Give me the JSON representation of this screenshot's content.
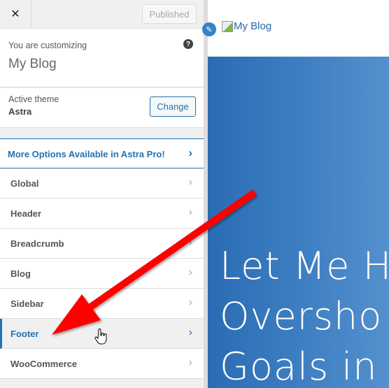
{
  "topbar": {
    "close_label": "✕",
    "published_label": "Published"
  },
  "info": {
    "customizing_label": "You are customizing",
    "site_name": "My Blog",
    "help_icon": "?"
  },
  "theme": {
    "label": "Active theme",
    "name": "Astra",
    "change_label": "Change"
  },
  "promo": {
    "label": "More Options Available in Astra Pro!"
  },
  "sections": [
    {
      "label": "Global",
      "active": false
    },
    {
      "label": "Header",
      "active": false
    },
    {
      "label": "Breadcrumb",
      "active": false
    },
    {
      "label": "Blog",
      "active": false
    },
    {
      "label": "Sidebar",
      "active": false
    },
    {
      "label": "Footer",
      "active": true
    },
    {
      "label": "WooCommerce",
      "active": false
    }
  ],
  "chevron": "›",
  "preview": {
    "logo_alt": "My Blog",
    "edit_icon": "✎",
    "hero_lines": [
      "Let Me H",
      "Oversho",
      "Goals in"
    ]
  },
  "colors": {
    "accent": "#2271b1",
    "arrow": "#ff0000",
    "hero_start": "#2a6cb4",
    "hero_end": "#5490cc"
  }
}
